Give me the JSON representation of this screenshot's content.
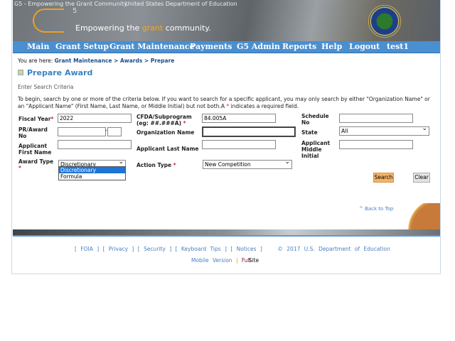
{
  "header": {
    "logo_alt": "G5 - Empowering the Grant Community",
    "seal_alt": "United States Department of Education",
    "logo_sup": "5",
    "tagline_pre": "Empowering the ",
    "tagline_accent": "grant",
    "tagline_post": " community."
  },
  "nav": [
    "Main",
    "Grant Setup",
    "Grant Maintenance",
    "Payments",
    "G5 Admin",
    "Reports",
    "Help",
    "Logout",
    "test1"
  ],
  "breadcrumb": {
    "prefix": "You are here: ",
    "path": "Grant Maintenance > Awards > Prepare"
  },
  "page_title": "Prepare Award",
  "section_title": "Enter Search Criteria",
  "intro_a": "To begin, search by one or more of the criteria below. If you want to search for a specific applicant, you may only search by either \"Organization Name\" or an \"Applicant Name\" (First Name, Last Name, or Middle Initial) but not both.A ",
  "intro_star": "*",
  "intro_b": " indicates a required field.",
  "form": {
    "fiscal_year": {
      "label": "Fiscal Year",
      "value": "2022"
    },
    "cfda": {
      "label1": "CFDA/Subprogram",
      "label2": "(eg: ##.###A)",
      "value": "84.005A"
    },
    "schedule_no": {
      "label1": "Schedule",
      "label2": "No",
      "value": ""
    },
    "pr_award": {
      "label1": "PR/Award",
      "label2": "No",
      "value": "",
      "suffix": "",
      "sep": "-"
    },
    "org_name": {
      "label": "Organization Name",
      "value": ""
    },
    "state": {
      "label": "State",
      "value": "All"
    },
    "first_name": {
      "label1": "Applicant",
      "label2": "First Name",
      "value": ""
    },
    "last_name": {
      "label": "Applicant Last Name",
      "value": ""
    },
    "middle_initial": {
      "label1": "Applicant",
      "label2": "Middle",
      "label3": "Initial",
      "value": ""
    },
    "award_type": {
      "label": "Award Type",
      "value": "Discretionary",
      "options": [
        "Discretionary",
        "Formula"
      ]
    },
    "action_type": {
      "label": "Action Type",
      "value": "New Competition"
    },
    "star": "*"
  },
  "buttons": {
    "search": "Search",
    "clear": "Clear"
  },
  "back_to_top": "^ Back to Top",
  "footer": {
    "links": [
      "FOIA",
      "Privacy",
      "Security",
      "Keyboard Tips",
      "Notices"
    ],
    "copyright": "© 2017 U.S. Department of Education",
    "mobile": "Mobile Version",
    "sep": "|",
    "full": "Full",
    "site": "Site"
  },
  "colors": {
    "nav": "#4a8fd0",
    "title": "#3a82c4",
    "search_button": "#f5b366",
    "accent": "#f5a623"
  }
}
